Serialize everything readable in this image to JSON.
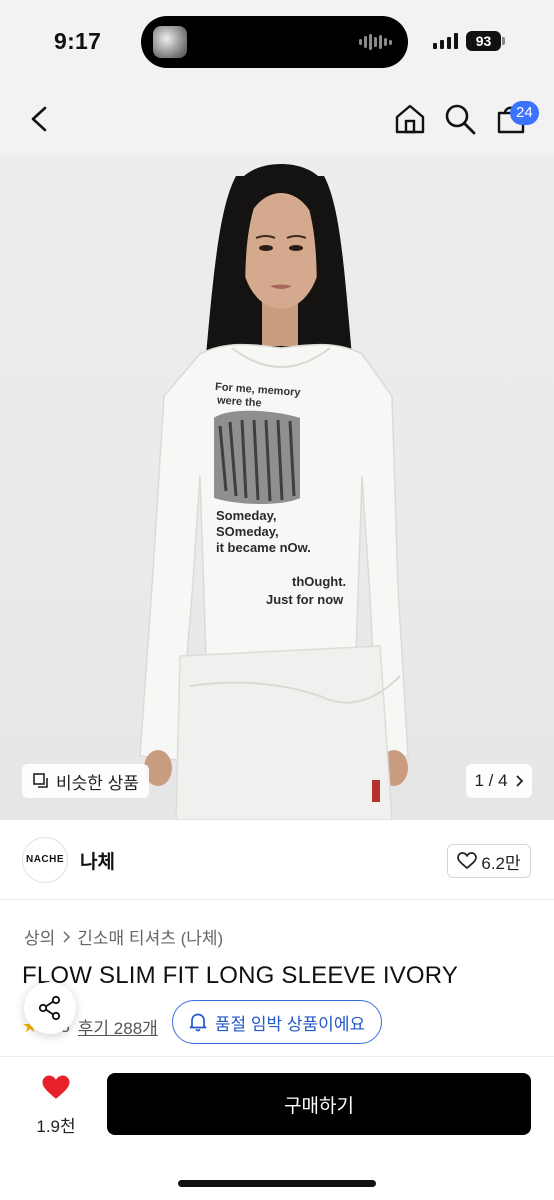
{
  "status_bar": {
    "time": "9:17",
    "battery": "93"
  },
  "nav": {
    "cart_count": "24"
  },
  "hero": {
    "similar_label": "비슷한 상품",
    "page_indicator": "1 / 4",
    "shirt_print": [
      "For me, memory",
      "were the",
      "Someday,",
      "SOmeday,",
      "it became nOw.",
      "thOught.",
      "Just for now"
    ]
  },
  "brand": {
    "logo_text": "NACHE",
    "name": "나체",
    "likes": "6.2만"
  },
  "breadcrumb": {
    "category": "상의",
    "subcategory": "긴소매 티셔츠 (나체)"
  },
  "product": {
    "title": "FLOW SLIM FIT LONG SLEEVE IVORY"
  },
  "rating": {
    "score": "4.8",
    "reviews": "후기 288개"
  },
  "soldout_chip": {
    "label": "품절 임박 상품이에요"
  },
  "bottom_bar": {
    "like_count": "1.9천",
    "buy_label": "구매하기"
  },
  "colors": {
    "accent_blue": "#3b73ff",
    "heart_red": "#e8202a",
    "buy_black": "#000000"
  }
}
